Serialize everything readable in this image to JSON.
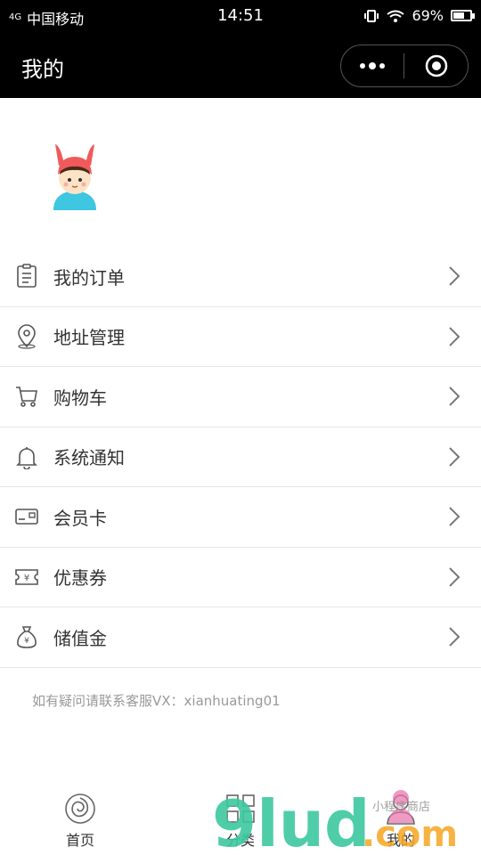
{
  "status_bar": {
    "signal": "4G",
    "carrier": "中国移动",
    "time": "14:51",
    "battery": "69%",
    "battery_level": 0.69
  },
  "title_bar": {
    "title": "我的",
    "more_icon": "more-dots-icon",
    "close_icon": "target-close-icon"
  },
  "avatar": {
    "icon": "bunny-hat-child-avatar"
  },
  "menu": {
    "items": [
      {
        "label": "我的订单",
        "icon": "clipboard-icon"
      },
      {
        "label": "地址管理",
        "icon": "location-pin-icon"
      },
      {
        "label": "购物车",
        "icon": "cart-icon"
      },
      {
        "label": "系统通知",
        "icon": "bell-icon"
      },
      {
        "label": "会员卡",
        "icon": "card-icon"
      },
      {
        "label": "优惠券",
        "icon": "coupon-icon"
      },
      {
        "label": "储值金",
        "icon": "money-bag-icon"
      }
    ]
  },
  "contact_text": "如有疑问请联系客服VX：xianhuating01",
  "tab_bar": {
    "tabs": [
      {
        "label": "首页",
        "icon": "rose-icon"
      },
      {
        "label": "分类",
        "icon": "grid-icon"
      },
      {
        "label": "我的",
        "icon": "user-icon"
      }
    ]
  },
  "watermark": {
    "text": "9lud.com",
    "sub_text": "小程序商店"
  },
  "colors": {
    "header_bg": "#000000",
    "text": "#333333",
    "muted": "#999999",
    "divider": "#e6e6e6",
    "watermark_green": "#3cc8a0",
    "watermark_orange": "#f5a623",
    "watermark_pink": "#e86fa8"
  }
}
